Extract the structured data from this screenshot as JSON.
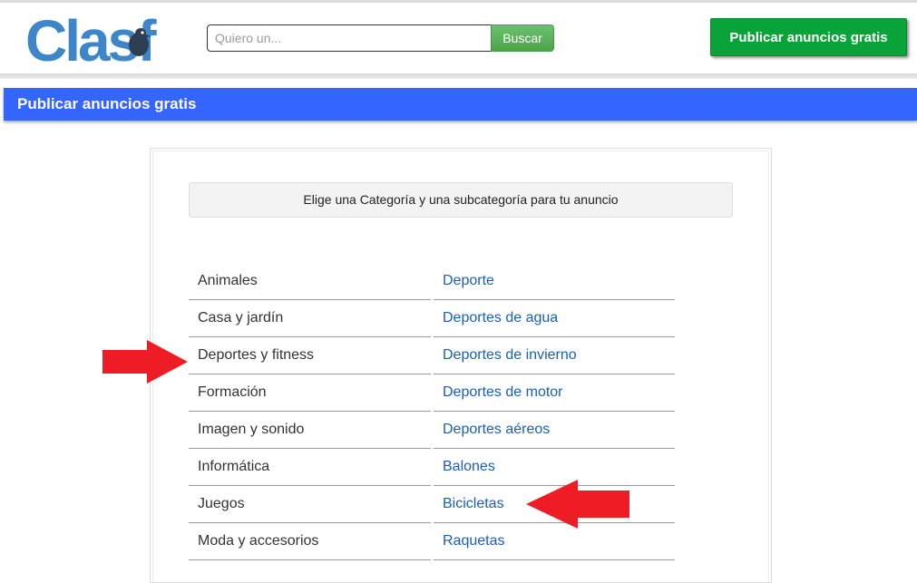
{
  "header": {
    "logo_text": "Clasf",
    "search": {
      "placeholder": "Quiero un...",
      "value": ""
    },
    "search_button": "Buscar",
    "publish_button": "Publicar anuncios gratis"
  },
  "title_bar": {
    "text": "Publicar anuncios gratis"
  },
  "notice": "Elige una Categoría y una subcategoría para tu anuncio",
  "categories": [
    "Animales",
    "Casa y jardín",
    "Deportes y fitness",
    "Formación",
    "Imagen y sonido",
    "Informática",
    "Juegos",
    "Moda y accesorios"
  ],
  "subcategories": [
    "Deporte",
    "Deportes de agua",
    "Deportes de invierno",
    "Deportes de motor",
    "Deportes aéreos",
    "Balones",
    "Bicicletas",
    "Raquetas"
  ],
  "colors": {
    "logo_blue": "#3d87c8",
    "logo_dark": "#2c3e50",
    "title_bar": "#3466ff",
    "publish_green": "#0aa33a",
    "search_green": "#4aa54a",
    "link_blue": "#1a5fb4",
    "arrow_red": "#ee1c25"
  },
  "icons": [
    "pigeon-logo-icon",
    "red-arrow-right-icon",
    "red-arrow-left-icon"
  ]
}
